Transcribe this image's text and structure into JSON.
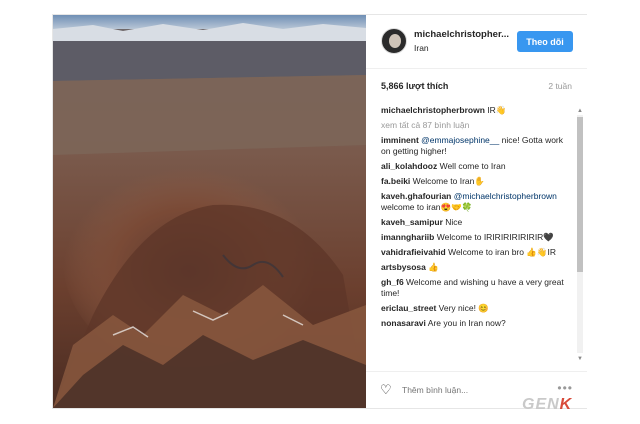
{
  "post": {
    "username": "michaelchristopher...",
    "location": "Iran",
    "follow_label": "Theo dõi",
    "likes": "5,866 lượt thích",
    "age": "2 tuần"
  },
  "caption": {
    "user": "michaelchristopherbrown",
    "text": " IR👋"
  },
  "view_all": "xem tất cả 87 bình luận",
  "comments": [
    {
      "user": "imminent",
      "mention": " @emmajosephine__",
      "text": " nice! Gotta work on getting higher!"
    },
    {
      "user": "ali_kolahdooz",
      "mention": "",
      "text": " Well come to Iran"
    },
    {
      "user": "fa.beiki",
      "mention": "",
      "text": " Welcome to Iran✋"
    },
    {
      "user": "kaveh.ghafourian",
      "mention": " @michaelchristopherbrown",
      "text": " welcome to iran😍🤝🍀"
    },
    {
      "user": "kaveh_samipur",
      "mention": "",
      "text": " Nice"
    },
    {
      "user": "imannghariib",
      "mention": "",
      "text": " Welcome to IRIRIRIRIRIRIR🖤"
    },
    {
      "user": "vahidrafieivahid",
      "mention": "",
      "text": " Welcome to iran bro 👍👋IR"
    },
    {
      "user": "artsbysosa",
      "mention": "",
      "text": " 👍"
    },
    {
      "user": "gh_f6",
      "mention": "",
      "text": " Welcome and wishing u have a very great time!"
    },
    {
      "user": "ericlau_street",
      "mention": "",
      "text": " Very nice! 😊"
    },
    {
      "user": "nonasaravi",
      "mention": "",
      "text": " Are you in Iran now?"
    }
  ],
  "footer": {
    "comment_placeholder": "Thêm bình luận...",
    "more_icon": "•••"
  },
  "watermark": {
    "prefix": "GEN",
    "suffix": "K"
  }
}
